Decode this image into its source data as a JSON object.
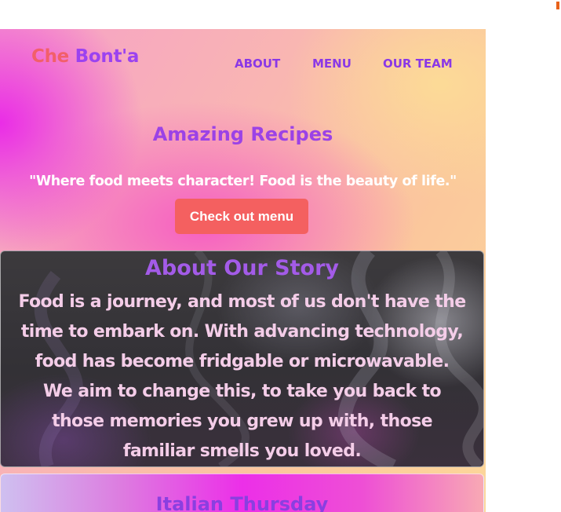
{
  "nav": {
    "logo_part1": "Che",
    "logo_part2": "Bont'a",
    "links": [
      "ABOUT",
      "MENU",
      "OUR TEAM"
    ]
  },
  "hero": {
    "title": "Amazing Recipes",
    "quote": "\"Where food meets character! Food is the beauty of life.\"",
    "button_label": "Check out menu"
  },
  "story": {
    "title": "About Our Story",
    "lines": [
      "Food is a journey, and most of us don't have the",
      "time to embark on. With advancing technology,",
      "food has become fridgable or microwavable.",
      "We aim to change this, to take you back to",
      "those memories you grew up with, those",
      "familiar smells you loved."
    ]
  },
  "next_section": {
    "title": "Italian Thursday"
  },
  "colors": {
    "logo_accent": "#f25f6a",
    "brand_purple": "#9b42f0",
    "button_bg": "#f46060"
  }
}
